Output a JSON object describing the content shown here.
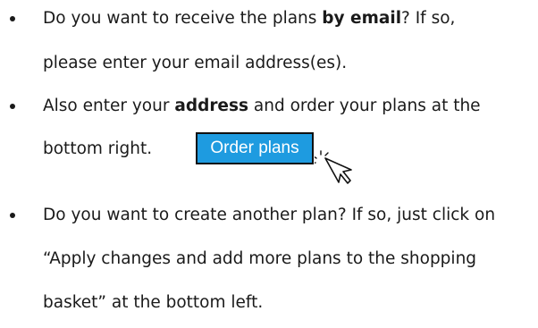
{
  "bullets": [
    {
      "lines": [
        {
          "t1": "Do you want to receive the plans ",
          "bold": "by email",
          "t2": "? If so,"
        },
        {
          "text": "please enter your email address(es)."
        }
      ]
    },
    {
      "lines": [
        {
          "t1": "Also enter your ",
          "bold": "address",
          "t2": " and order your plans at the"
        },
        {
          "text": "bottom right."
        }
      ]
    },
    {
      "lines": [
        {
          "text": "Do you want to create another plan? If so, just click on"
        },
        {
          "text": "“Apply changes and add more plans to the shopping"
        },
        {
          "text": "basket” at the bottom left."
        }
      ]
    }
  ],
  "order_button": {
    "label": "Order plans"
  },
  "colors": {
    "button_bg": "#1e9be0",
    "button_border": "#111111",
    "button_text": "#ffffff",
    "text": "#1a1a1a"
  },
  "icons": {
    "cursor": "pointer-hand-click-icon",
    "bullet": "bullet-dot-icon"
  }
}
